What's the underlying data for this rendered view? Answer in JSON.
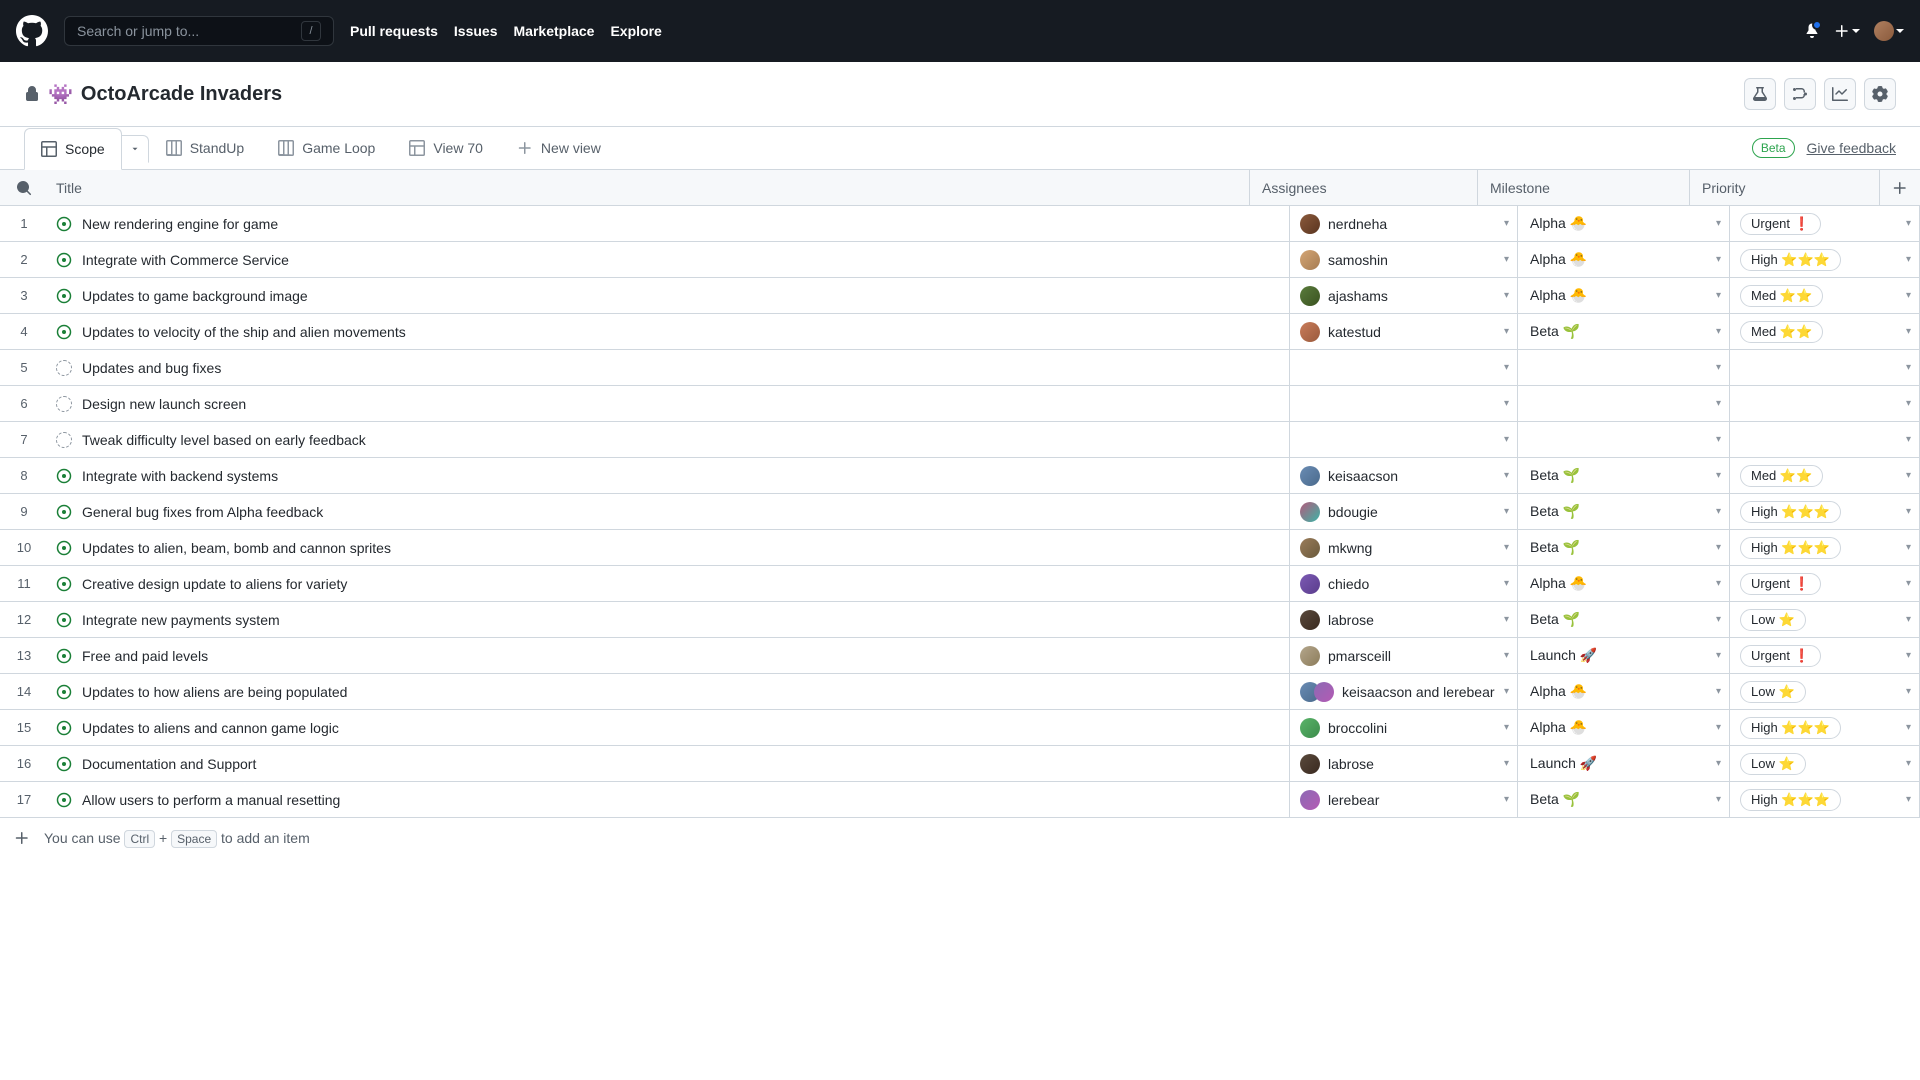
{
  "topbar": {
    "search_placeholder": "Search or jump to...",
    "nav": {
      "pulls": "Pull requests",
      "issues": "Issues",
      "marketplace": "Marketplace",
      "explore": "Explore"
    }
  },
  "project": {
    "emoji": "👾",
    "title": "OctoArcade Invaders"
  },
  "tabs": {
    "scope": "Scope",
    "standup": "StandUp",
    "gameloop": "Game Loop",
    "view70": "View 70",
    "newview": "New view",
    "beta": "Beta",
    "feedback": "Give feedback"
  },
  "columns": {
    "title": "Title",
    "assignees": "Assignees",
    "milestone": "Milestone",
    "priority": "Priority"
  },
  "milestones": {
    "alpha": "Alpha 🐣",
    "beta": "Beta 🌱",
    "launch": "Launch 🚀"
  },
  "priorities": {
    "urgent": "Urgent ❗",
    "high": "High ⭐⭐⭐",
    "med": "Med ⭐⭐",
    "low": "Low ⭐"
  },
  "rows": [
    {
      "num": "1",
      "status": "open",
      "title": "New rendering engine for game",
      "assignee": "nerdneha",
      "avatar": "av1",
      "milestone": "alpha",
      "priority": "urgent"
    },
    {
      "num": "2",
      "status": "open",
      "title": "Integrate with Commerce Service",
      "assignee": "samoshin",
      "avatar": "av2",
      "milestone": "alpha",
      "priority": "high"
    },
    {
      "num": "3",
      "status": "open",
      "title": "Updates to game background image",
      "assignee": "ajashams",
      "avatar": "av3",
      "milestone": "alpha",
      "priority": "med"
    },
    {
      "num": "4",
      "status": "open",
      "title": "Updates to velocity of the ship and alien movements",
      "assignee": "katestud",
      "avatar": "av4",
      "milestone": "beta",
      "priority": "med"
    },
    {
      "num": "5",
      "status": "draft",
      "title": "Updates and bug fixes",
      "assignee": "",
      "avatar": "",
      "milestone": "",
      "priority": ""
    },
    {
      "num": "6",
      "status": "draft",
      "title": "Design new launch screen",
      "assignee": "",
      "avatar": "",
      "milestone": "",
      "priority": ""
    },
    {
      "num": "7",
      "status": "draft",
      "title": "Tweak difficulty level based on early feedback",
      "assignee": "",
      "avatar": "",
      "milestone": "",
      "priority": ""
    },
    {
      "num": "8",
      "status": "open",
      "title": "Integrate with backend systems",
      "assignee": "keisaacson",
      "avatar": "av5",
      "milestone": "beta",
      "priority": "med"
    },
    {
      "num": "9",
      "status": "open",
      "title": "General bug fixes from Alpha feedback",
      "assignee": "bdougie",
      "avatar": "av6",
      "milestone": "beta",
      "priority": "high"
    },
    {
      "num": "10",
      "status": "open",
      "title": "Updates to alien, beam, bomb and cannon sprites",
      "assignee": "mkwng",
      "avatar": "av7",
      "milestone": "beta",
      "priority": "high"
    },
    {
      "num": "11",
      "status": "open",
      "title": "Creative design update to aliens for variety",
      "assignee": "chiedo",
      "avatar": "av8",
      "milestone": "alpha",
      "priority": "urgent"
    },
    {
      "num": "12",
      "status": "open",
      "title": "Integrate new payments system",
      "assignee": "labrose",
      "avatar": "av9",
      "milestone": "beta",
      "priority": "low"
    },
    {
      "num": "13",
      "status": "open",
      "title": "Free and paid levels",
      "assignee": "pmarsceill",
      "avatar": "av10",
      "milestone": "launch",
      "priority": "urgent"
    },
    {
      "num": "14",
      "status": "open",
      "title": "Updates to how aliens are being populated",
      "assignee": "keisaacson and lerebear",
      "avatar": "av5",
      "avatar2": "av12",
      "milestone": "alpha",
      "priority": "low"
    },
    {
      "num": "15",
      "status": "open",
      "title": "Updates to aliens and cannon game logic",
      "assignee": "broccolini",
      "avatar": "av11",
      "milestone": "alpha",
      "priority": "high"
    },
    {
      "num": "16",
      "status": "open",
      "title": "Documentation and Support",
      "assignee": "labrose",
      "avatar": "av9",
      "milestone": "launch",
      "priority": "low"
    },
    {
      "num": "17",
      "status": "open",
      "title": "Allow users to perform a manual resetting",
      "assignee": "lerebear",
      "avatar": "av12",
      "milestone": "beta",
      "priority": "high"
    }
  ],
  "footer": {
    "prefix": "You can use",
    "ctrl": "Ctrl",
    "plus": "+",
    "space": "Space",
    "suffix": "to add an item"
  }
}
